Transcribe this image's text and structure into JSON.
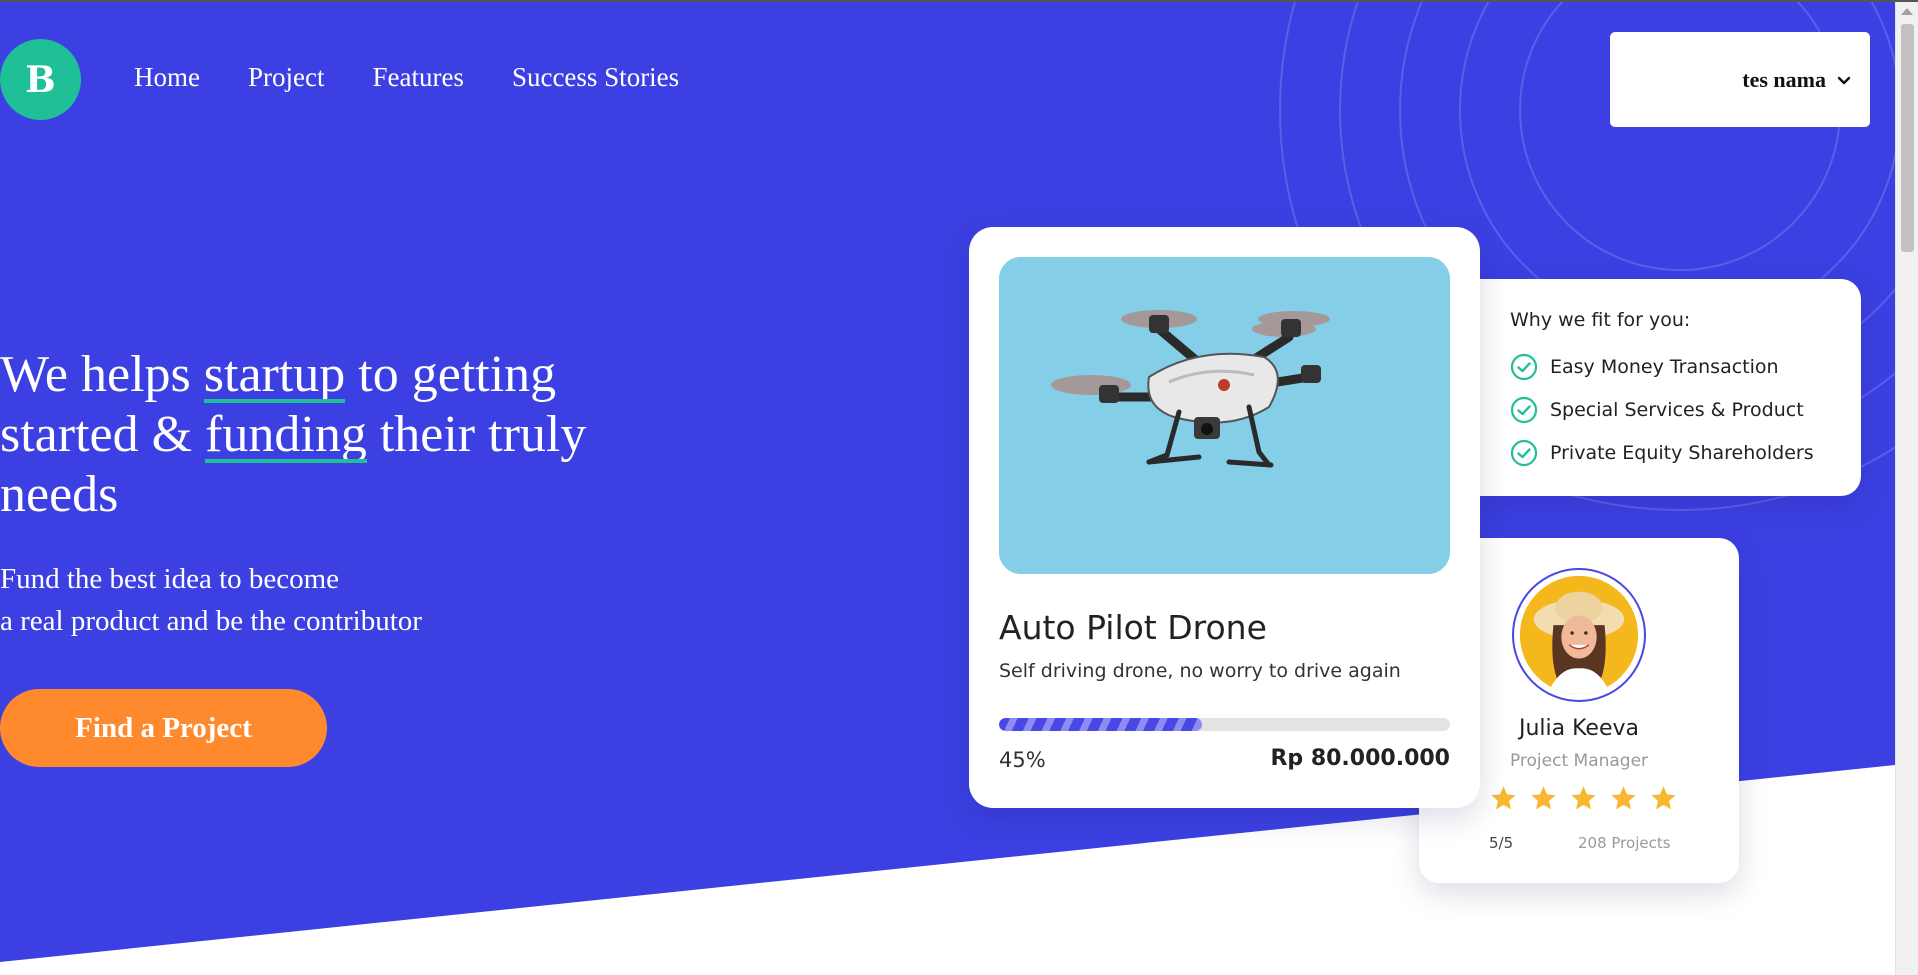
{
  "brand": {
    "logo_letter": "B"
  },
  "nav": {
    "items": [
      {
        "label": "Home"
      },
      {
        "label": "Project"
      },
      {
        "label": "Features"
      },
      {
        "label": "Success Stories"
      }
    ]
  },
  "user_menu": {
    "name": "tes nama",
    "icon": "chevron-down-icon"
  },
  "hero": {
    "headline_part1": "We helps ",
    "headline_hl1": "startup",
    "headline_part2": " to getting started & ",
    "headline_hl2": "funding",
    "headline_part3": " their truly needs",
    "subtitle_line1": "Fund the best idea to become",
    "subtitle_line2": "a real product and be the contributor",
    "cta_label": "Find a Project"
  },
  "project_card": {
    "title": "Auto Pilot Drone",
    "description": "Self driving drone, no worry to drive again",
    "progress": 0.45,
    "progress_label": "45%",
    "amount": "Rp 80.000.000"
  },
  "why_card": {
    "title": "Why we fit for you:",
    "items": [
      {
        "label": "Easy Money Transaction"
      },
      {
        "label": "Special Services & Product"
      },
      {
        "label": "Private Equity Shareholders"
      }
    ]
  },
  "profile_card": {
    "name": "Julia Keeva",
    "role": "Project Manager",
    "stars": 5,
    "rating": "5/5",
    "projects": "208 Projects"
  },
  "colors": {
    "primary": "#3c40e2",
    "accent_green": "#1fbf98",
    "cta_orange": "#ff8a2e",
    "star": "#f7b733"
  }
}
